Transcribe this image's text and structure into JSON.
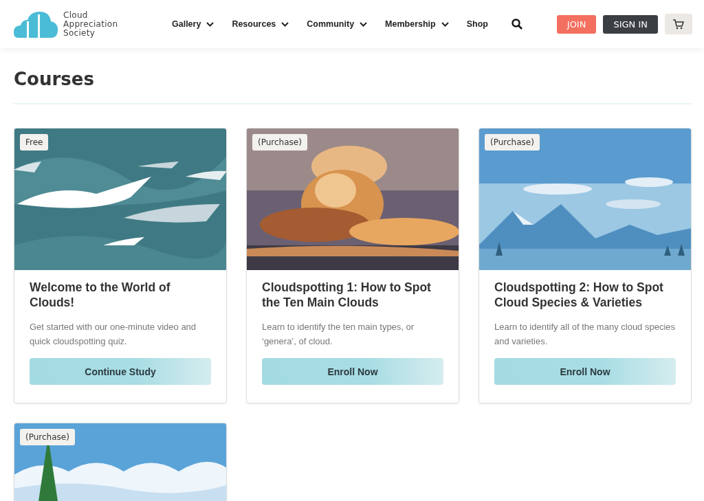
{
  "header": {
    "logo_text": [
      "Cloud",
      "Appreciation",
      "Society"
    ],
    "nav": [
      {
        "label": "Gallery",
        "dropdown": true
      },
      {
        "label": "Resources",
        "dropdown": true
      },
      {
        "label": "Community",
        "dropdown": true
      },
      {
        "label": "Membership",
        "dropdown": true
      },
      {
        "label": "Shop",
        "dropdown": false
      }
    ],
    "join": "JOIN",
    "sign_in": "SIGN IN"
  },
  "page_title": "Courses",
  "courses": [
    {
      "badge": "Free",
      "title": "Welcome to the World of Clouds!",
      "description": "Get started with our one-minute video and quick cloudspotting quiz.",
      "button": "Continue Study"
    },
    {
      "badge": "(Purchase)",
      "title": "Cloudspotting 1: How to Spot the Ten Main Clouds",
      "description": "Learn to identify the ten main types, or ‘genera’, of cloud.",
      "button": "Enroll Now"
    },
    {
      "badge": "(Purchase)",
      "title": "Cloudspotting 2: How to Spot Cloud Species & Varieties",
      "description": "Learn to identify all of the many cloud species and varieties.",
      "button": "Enroll Now"
    },
    {
      "badge": "(Purchase)"
    }
  ]
}
